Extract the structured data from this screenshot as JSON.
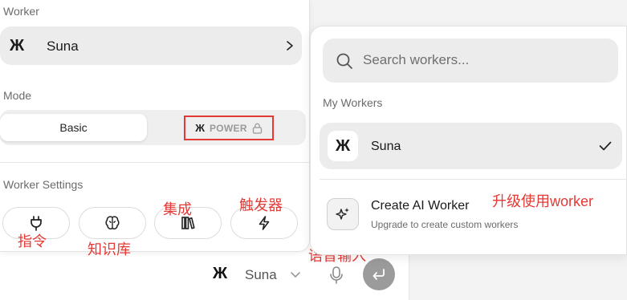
{
  "left_panel": {
    "worker_label": "Worker",
    "worker_logo": "Ж",
    "worker_name": "Suna",
    "mode_label": "Mode",
    "mode_basic": "Basic",
    "mode_power_logo": "Ж",
    "mode_power": "POWER",
    "settings_label": "Worker Settings",
    "settings_icons": [
      "plug-icon",
      "brain-icon",
      "books-icon",
      "bolt-icon"
    ]
  },
  "annotations": {
    "instructions": "指令",
    "knowledge": "知识库",
    "integrations": "集成",
    "triggers": "触发器",
    "voice_input": "语音输入",
    "upgrade_note": "升级使用worker"
  },
  "dropdown": {
    "search_placeholder": "Search workers...",
    "my_workers_label": "My Workers",
    "selected_logo": "Ж",
    "selected_name": "Suna",
    "create_title": "Create AI Worker",
    "create_subtitle": "Upgrade to create custom workers"
  },
  "chat_bar": {
    "logo": "Ж",
    "worker_name": "Suna"
  },
  "colors": {
    "annotation": "#e53935",
    "send_button": "#9b9b9b",
    "selected_bg": "#ececec"
  }
}
